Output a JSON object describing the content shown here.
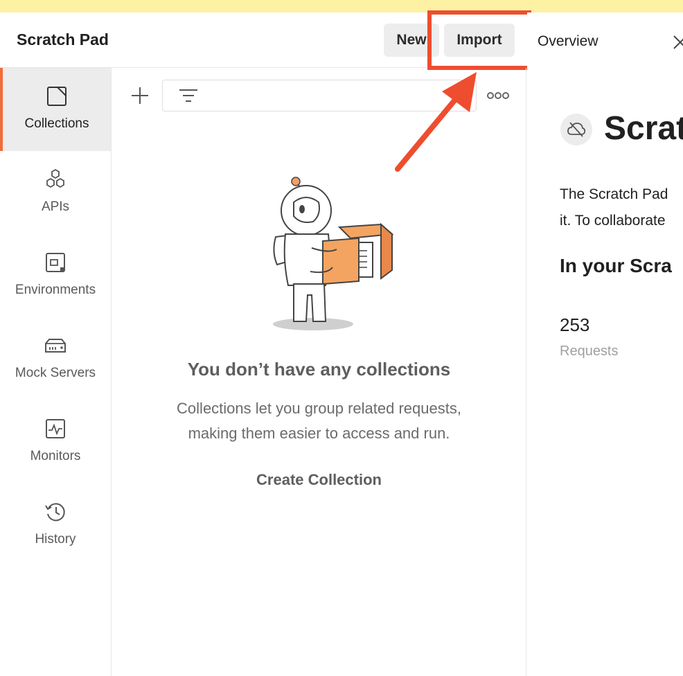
{
  "workspace": {
    "title": "Scratch Pad",
    "new_label": "New",
    "import_label": "Import"
  },
  "sidebar": {
    "items": [
      {
        "label": "Collections",
        "icon": "collections-icon",
        "active": true
      },
      {
        "label": "APIs",
        "icon": "apis-icon"
      },
      {
        "label": "Environments",
        "icon": "environments-icon"
      },
      {
        "label": "Mock Servers",
        "icon": "mock-servers-icon"
      },
      {
        "label": "Monitors",
        "icon": "monitors-icon"
      },
      {
        "label": "History",
        "icon": "history-icon"
      }
    ]
  },
  "collections_panel": {
    "empty_title": "You don’t have any collections",
    "empty_desc_line1": "Collections let you group related requests,",
    "empty_desc_line2": "making them easier to access and run.",
    "create_label": "Create Collection"
  },
  "overview": {
    "tab_label": "Overview",
    "title": "Scrat",
    "desc_line1": "The Scratch Pad",
    "desc_line2": "it. To collaborate",
    "subheading": "In your Scra",
    "count": "253",
    "count_label": "Requests"
  },
  "colors": {
    "accent": "#f26b3a",
    "highlight": "#ee4d2f",
    "banner": "#fdf1a4"
  }
}
